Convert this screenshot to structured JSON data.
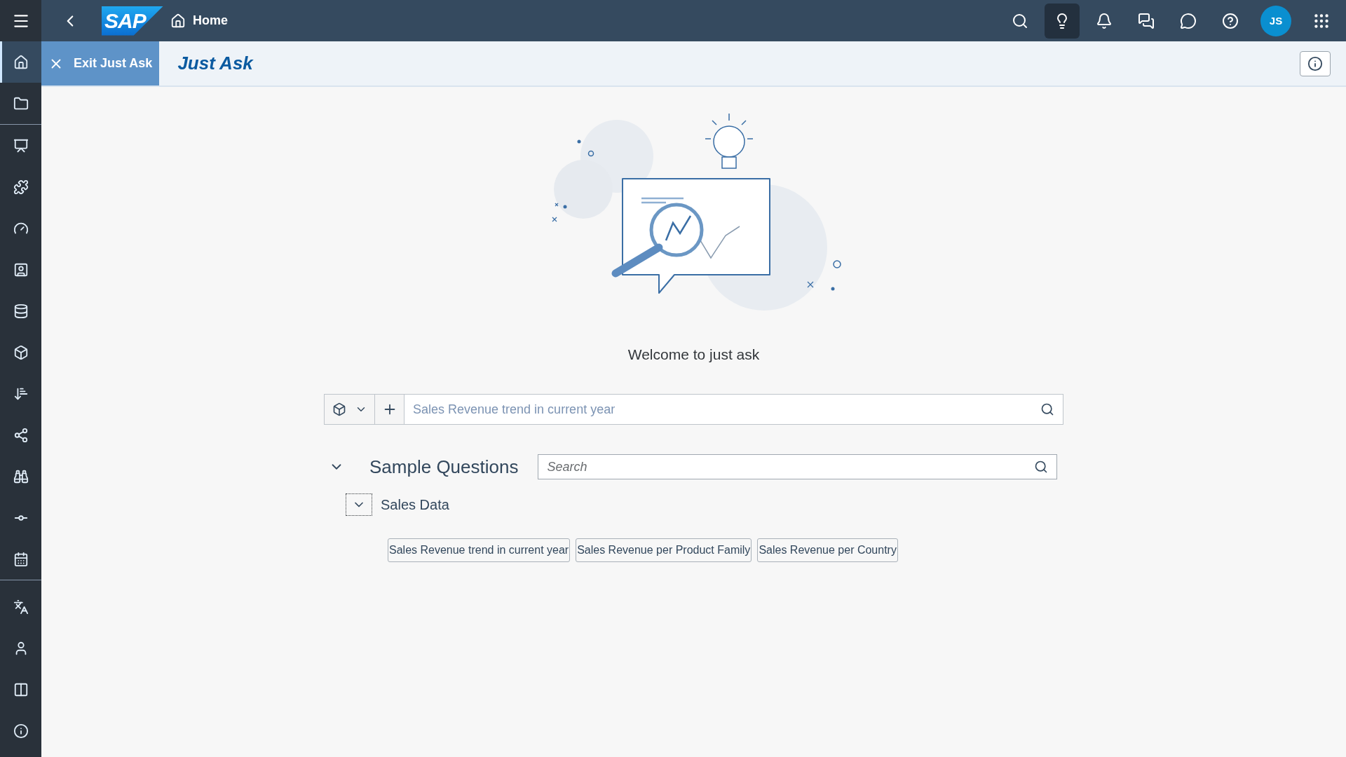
{
  "shell": {
    "logo": "SAP",
    "title": "Home",
    "avatar": "JS",
    "actions": [
      {
        "selected": false
      },
      {
        "selected": true
      },
      {
        "selected": false
      },
      {
        "selected": false
      },
      {
        "selected": false
      },
      {
        "selected": false
      }
    ]
  },
  "sidebar": {
    "groups": [
      {
        "items": [
          {
            "selected": true
          },
          {
            "selected": false
          }
        ]
      },
      {
        "items": [
          {
            "selected": false
          },
          {
            "selected": false
          },
          {
            "selected": false
          },
          {
            "selected": false
          },
          {
            "selected": false
          },
          {
            "selected": false
          },
          {
            "selected": false
          },
          {
            "selected": false
          },
          {
            "selected": false
          },
          {
            "selected": false
          },
          {
            "selected": false
          }
        ]
      },
      {
        "items": [
          {
            "selected": false
          },
          {
            "selected": false
          },
          {
            "selected": false
          },
          {
            "selected": false
          }
        ]
      }
    ]
  },
  "subheader": {
    "exit_button": "Exit Just Ask",
    "title": "Just Ask"
  },
  "welcome": "Welcome to just ask",
  "query": {
    "placeholder": "Sales Revenue trend in current year"
  },
  "sample_questions": {
    "title": "Sample Questions",
    "expanded": true,
    "search": {
      "placeholder": "Search"
    },
    "groups": [
      {
        "title": "Sales Data",
        "expanded": true,
        "questions": [
          "Sales Revenue trend in current year",
          "Sales Revenue per Product Family",
          "Sales Revenue per Country"
        ]
      }
    ]
  }
}
